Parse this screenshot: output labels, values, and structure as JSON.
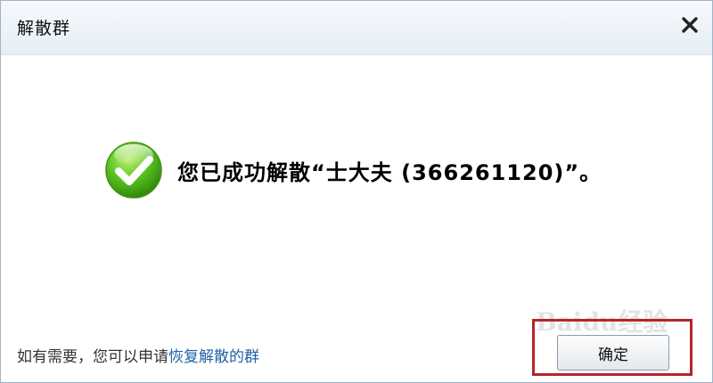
{
  "dialog": {
    "title": "解散群",
    "close_icon": "close-icon",
    "message": "您已成功解散“士大夫 (366261120)”。",
    "success_icon": "check-circle-icon",
    "footer_prefix": "如有需要，您可以申请",
    "footer_link": "恢复解散的群",
    "ok_label": "确定",
    "watermark": "Baidu经验"
  },
  "colors": {
    "link": "#1e63a8",
    "highlight_border": "#b3262b",
    "check_green": "#4fb41a"
  }
}
